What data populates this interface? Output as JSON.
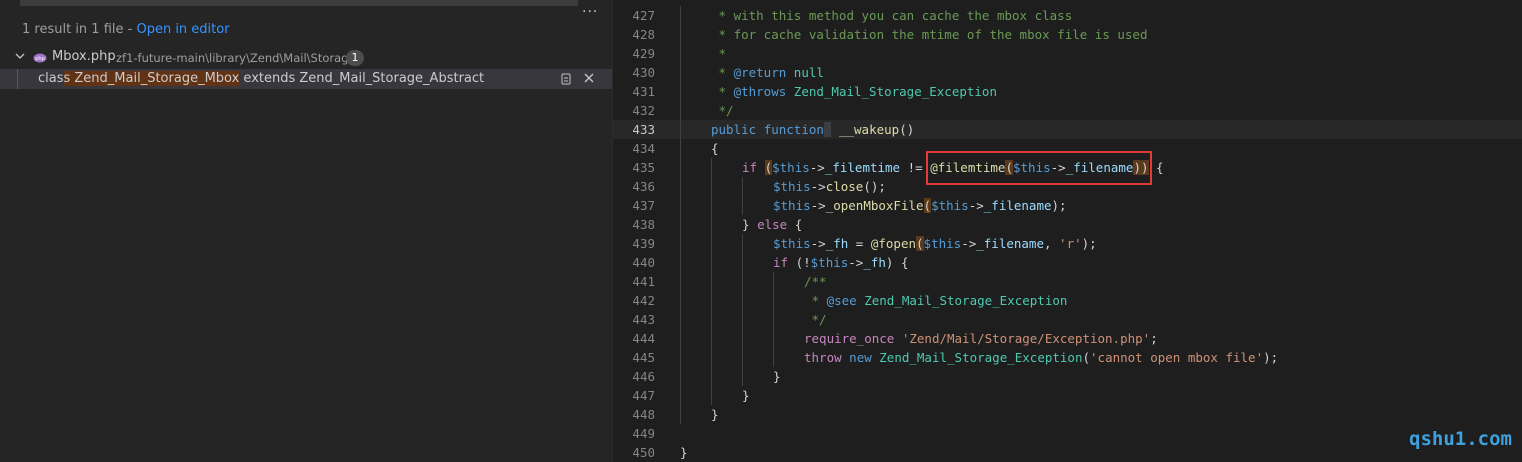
{
  "search": {
    "summary": "1 result in 1 file - ",
    "open_in_editor": "Open in editor",
    "file": {
      "name": "Mbox.php",
      "path": "zf1-future-main\\library\\Zend\\Mail\\Storage",
      "count": "1"
    },
    "match": {
      "before": "clas",
      "highlight": "s Zend_Mail_Storage_Mbox",
      "after": " extends Zend_Mail_Storage_Abstract"
    }
  },
  "editor": {
    "current_line": 433,
    "lines": [
      {
        "n": 427,
        "indent": 1,
        "tokens": [
          [
            "c",
            " * with this method you can cache the mbox class"
          ]
        ]
      },
      {
        "n": 428,
        "indent": 1,
        "tokens": [
          [
            "c",
            " * for cache validation the mtime of the mbox file is used"
          ]
        ]
      },
      {
        "n": 429,
        "indent": 1,
        "tokens": [
          [
            "c",
            " *"
          ]
        ]
      },
      {
        "n": 430,
        "indent": 1,
        "tokens": [
          [
            "c",
            " * "
          ],
          [
            "ck",
            "@return"
          ],
          [
            "ct",
            " null"
          ]
        ]
      },
      {
        "n": 431,
        "indent": 1,
        "tokens": [
          [
            "c",
            " * "
          ],
          [
            "ck",
            "@throws"
          ],
          [
            "ct",
            " Zend_Mail_Storage_Exception"
          ]
        ]
      },
      {
        "n": 432,
        "indent": 1,
        "tokens": [
          [
            "c",
            " */"
          ]
        ]
      },
      {
        "n": 433,
        "indent": 1,
        "tokens": [
          [
            "k",
            "public"
          ],
          [
            "t",
            " "
          ],
          [
            "k",
            "function"
          ],
          [
            "sel",
            " "
          ],
          [
            "t",
            " "
          ],
          [
            "f",
            "__wakeup"
          ],
          [
            "t",
            "()"
          ]
        ]
      },
      {
        "n": 434,
        "indent": 1,
        "tokens": [
          [
            "t",
            "{"
          ]
        ]
      },
      {
        "n": 435,
        "indent": 2,
        "tokens": [
          [
            "p",
            "if"
          ],
          [
            "t",
            " "
          ],
          [
            "br",
            "("
          ],
          [
            "v",
            "$this"
          ],
          [
            "t",
            "->"
          ],
          [
            "v2",
            "_filemtime"
          ],
          [
            "t",
            " != "
          ],
          [
            "f",
            "@filemtime"
          ],
          [
            "br",
            "("
          ],
          [
            "v",
            "$this"
          ],
          [
            "t",
            "->"
          ],
          [
            "v2",
            "_filename"
          ],
          [
            "br",
            ")"
          ],
          [
            "br",
            ")"
          ],
          [
            "t",
            " {"
          ]
        ]
      },
      {
        "n": 436,
        "indent": 3,
        "tokens": [
          [
            "v",
            "$this"
          ],
          [
            "t",
            "->"
          ],
          [
            "f",
            "close"
          ],
          [
            "t",
            "();"
          ]
        ]
      },
      {
        "n": 437,
        "indent": 3,
        "tokens": [
          [
            "v",
            "$this"
          ],
          [
            "t",
            "->"
          ],
          [
            "f",
            "_openMboxFile"
          ],
          [
            "br",
            "("
          ],
          [
            "v",
            "$this"
          ],
          [
            "t",
            "->"
          ],
          [
            "v2",
            "_filename"
          ],
          [
            "t",
            ");"
          ]
        ]
      },
      {
        "n": 438,
        "indent": 2,
        "tokens": [
          [
            "t",
            "} "
          ],
          [
            "p",
            "else"
          ],
          [
            "t",
            " {"
          ]
        ]
      },
      {
        "n": 439,
        "indent": 3,
        "tokens": [
          [
            "v",
            "$this"
          ],
          [
            "t",
            "->"
          ],
          [
            "v2",
            "_fh"
          ],
          [
            "t",
            " = "
          ],
          [
            "f",
            "@fopen"
          ],
          [
            "br",
            "("
          ],
          [
            "v",
            "$this"
          ],
          [
            "t",
            "->"
          ],
          [
            "v2",
            "_filename"
          ],
          [
            "t",
            ", "
          ],
          [
            "s",
            "'r'"
          ],
          [
            "t",
            ");"
          ]
        ]
      },
      {
        "n": 440,
        "indent": 3,
        "tokens": [
          [
            "p",
            "if"
          ],
          [
            "t",
            " (!"
          ],
          [
            "v",
            "$this"
          ],
          [
            "t",
            "->"
          ],
          [
            "v2",
            "_fh"
          ],
          [
            "t",
            ") {"
          ]
        ]
      },
      {
        "n": 441,
        "indent": 4,
        "tokens": [
          [
            "c",
            "/**"
          ]
        ]
      },
      {
        "n": 442,
        "indent": 4,
        "tokens": [
          [
            "c",
            " * "
          ],
          [
            "ck",
            "@see"
          ],
          [
            "ct",
            " Zend_Mail_Storage_Exception"
          ]
        ]
      },
      {
        "n": 443,
        "indent": 4,
        "tokens": [
          [
            "c",
            " */"
          ]
        ]
      },
      {
        "n": 444,
        "indent": 4,
        "tokens": [
          [
            "p",
            "require_once"
          ],
          [
            "t",
            " "
          ],
          [
            "s",
            "'Zend/Mail/Storage/Exception.php'"
          ],
          [
            "t",
            ";"
          ]
        ]
      },
      {
        "n": 445,
        "indent": 4,
        "tokens": [
          [
            "p",
            "throw"
          ],
          [
            "t",
            " "
          ],
          [
            "k",
            "new"
          ],
          [
            "t",
            " "
          ],
          [
            "cls",
            "Zend_Mail_Storage_Exception"
          ],
          [
            "t",
            "("
          ],
          [
            "s",
            "'cannot open mbox file'"
          ],
          [
            "t",
            ");"
          ]
        ]
      },
      {
        "n": 446,
        "indent": 3,
        "tokens": [
          [
            "t",
            "}"
          ]
        ]
      },
      {
        "n": 447,
        "indent": 2,
        "tokens": [
          [
            "t",
            "}"
          ]
        ]
      },
      {
        "n": 448,
        "indent": 1,
        "tokens": [
          [
            "t",
            "}"
          ]
        ]
      },
      {
        "n": 449,
        "indent": 0,
        "tokens": []
      },
      {
        "n": 450,
        "indent": 0,
        "tokens": [
          [
            "t",
            "}"
          ]
        ]
      }
    ]
  },
  "watermark": "qshu1.com",
  "colors": {
    "c": "#6a9955",
    "ck": "#569cd6",
    "ct": "#4ec9b0",
    "k": "#569cd6",
    "p": "#c586c0",
    "f": "#dcdcaa",
    "v": "#569cd6",
    "v2": "#9cdcfe",
    "s": "#ce9178",
    "cls": "#4ec9b0",
    "t": "#d4d4d4",
    "br": "#d4d4d4",
    "sel": "#d4d4d4"
  }
}
